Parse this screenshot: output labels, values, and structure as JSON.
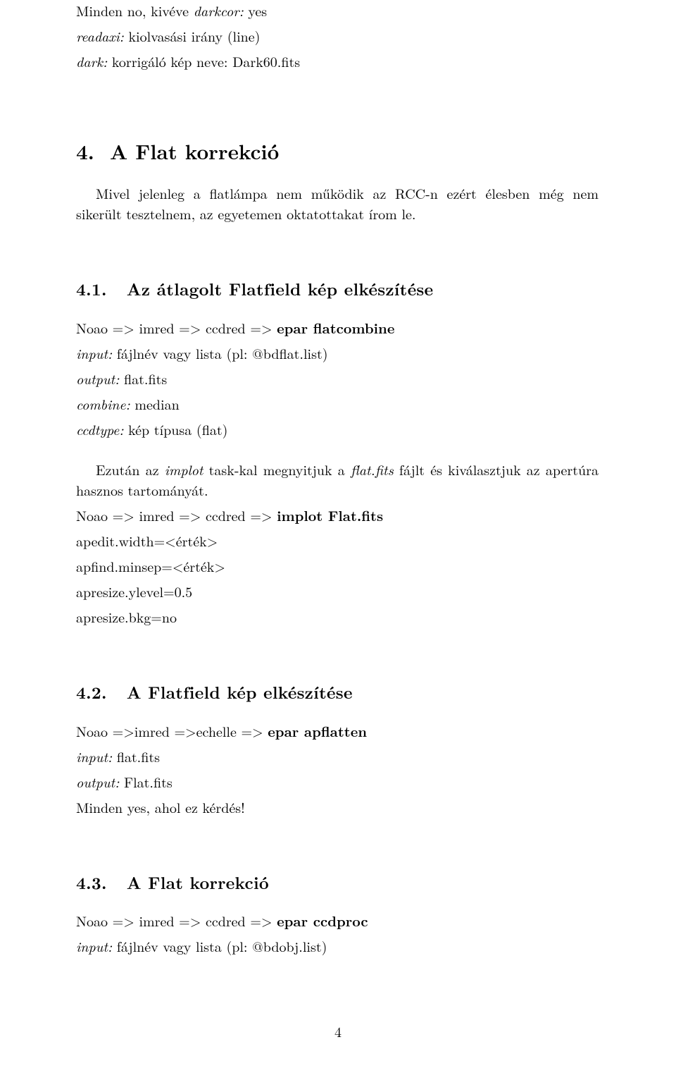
{
  "intro": {
    "l1_pre": "Minden no, kivéve ",
    "l1_i": "darkcor:",
    "l1_post": " yes",
    "l2_i": "readaxi:",
    "l2_post": " kiolvasási irány (line)",
    "l3_i": "dark:",
    "l3_post": " korrigáló kép neve: Dark60.fits"
  },
  "s4": {
    "num": "4.",
    "title": "A Flat korrekció",
    "p1": "Mivel jelenleg a flatlámpa nem működik az RCC-n ezért élesben még nem sikerült tesztelnem, az egyetemen oktatottakat írom le."
  },
  "s41": {
    "num": "4.1.",
    "title": "Az átlagolt Flatfield kép elkészítése",
    "l1_pre": "Noao => imred => ccdred => ",
    "l1_b": "epar flatcombine",
    "l2_i": "input:",
    "l2_post": " fájlnév vagy lista (pl: @bdflat.list)",
    "l3_i": "output:",
    "l3_post": " flat.fits",
    "l4_i": "combine:",
    "l4_post": " median",
    "l5_i": "ccdtype:",
    "l5_post": " kép típusa (flat)",
    "p2_pre": "Ezután az ",
    "p2_i1": "implot",
    "p2_mid1": " task-kal megnyitjuk a ",
    "p2_i2": "flat.fits",
    "p2_post": " fájlt és kiválasztjuk az apertúra hasznos tartományát.",
    "l6_pre": "Noao => imred => ccdred => ",
    "l6_b": "implot Flat.fits",
    "l7": "apedit.width=<érték>",
    "l8": "apfind.minsep=<érték>",
    "l9": "apresize.ylevel=0.5",
    "l10": "apresize.bkg=no"
  },
  "s42": {
    "num": "4.2.",
    "title": "A Flatfield kép elkészítése",
    "l1_pre": "Noao =>imred =>echelle => ",
    "l1_b": "epar apflatten",
    "l2_i": "input:",
    "l2_post": " flat.fits",
    "l3_i": "output:",
    "l3_post": " Flat.fits",
    "l4": "Minden yes, ahol ez kérdés!"
  },
  "s43": {
    "num": "4.3.",
    "title": "A Flat korrekció",
    "l1_pre": "Noao => imred => ccdred => ",
    "l1_b": "epar ccdproc",
    "l2_i": "input:",
    "l2_post": " fájlnév vagy lista (pl: @bdobj.list)"
  },
  "pagenum": "4"
}
